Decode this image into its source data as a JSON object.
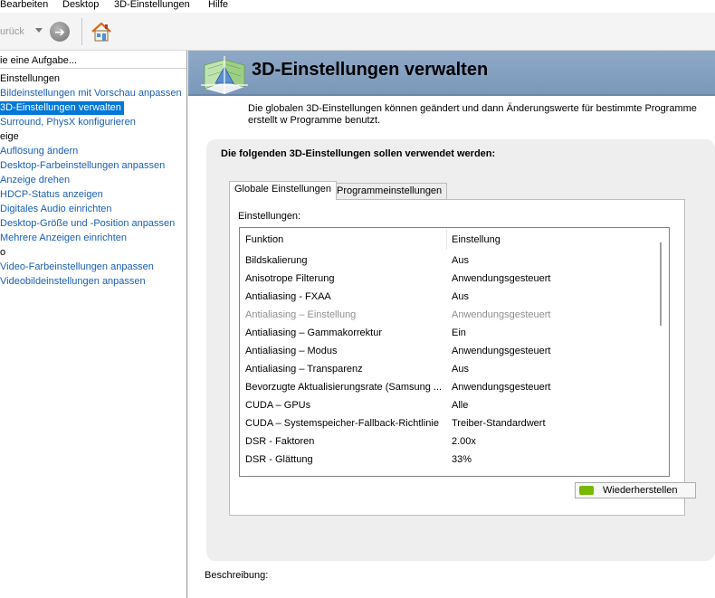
{
  "menu": [
    "Bearbeiten",
    "Desktop",
    "3D-Einstellungen",
    "Hilfe"
  ],
  "toolbar": {
    "back_label": "urück"
  },
  "left": {
    "task_header": "ie eine Aufgabe...",
    "tree": [
      {
        "text": "Einstellungen",
        "type": "cat"
      },
      {
        "text": "Bildeinstellungen mit Vorschau anpassen",
        "type": "link"
      },
      {
        "text": "3D-Einstellungen verwalten",
        "type": "sel"
      },
      {
        "text": "Surround, PhysX konfigurieren",
        "type": "link"
      },
      {
        "text": "eige",
        "type": "cat"
      },
      {
        "text": "Auflösung ändern",
        "type": "link"
      },
      {
        "text": "Desktop-Farbeinstellungen anpassen",
        "type": "link"
      },
      {
        "text": "Anzeige drehen",
        "type": "link"
      },
      {
        "text": "HDCP-Status anzeigen",
        "type": "link"
      },
      {
        "text": "Digitales Audio einrichten",
        "type": "link"
      },
      {
        "text": "Desktop-Größe und -Position anpassen",
        "type": "link"
      },
      {
        "text": "Mehrere Anzeigen einrichten",
        "type": "link"
      },
      {
        "text": "o",
        "type": "cat"
      },
      {
        "text": "Video-Farbeinstellungen anpassen",
        "type": "link"
      },
      {
        "text": "Videobildeinstellungen anpassen",
        "type": "link"
      }
    ]
  },
  "main": {
    "title": "3D-Einstellungen verwalten",
    "description": "Die globalen 3D-Einstellungen können geändert und dann Änderungswerte für bestimmte Programme erstellt w Programme benutzt.",
    "box_title": "Die folgenden 3D-Einstellungen sollen verwendet werden:",
    "tabs": [
      "Globale Einstellungen",
      "Programmeinstellungen"
    ],
    "settings_label": "Einstellungen:",
    "columns": [
      "Funktion",
      "Einstellung"
    ],
    "rows": [
      {
        "fn": "Bildskalierung",
        "val": "Aus",
        "disabled": false
      },
      {
        "fn": "Anisotrope Filterung",
        "val": "Anwendungsgesteuert",
        "disabled": false
      },
      {
        "fn": "Antialiasing - FXAA",
        "val": "Aus",
        "disabled": false
      },
      {
        "fn": "Antialiasing – Einstellung",
        "val": "Anwendungsgesteuert",
        "disabled": true
      },
      {
        "fn": "Antialiasing – Gammakorrektur",
        "val": "Ein",
        "disabled": false
      },
      {
        "fn": "Antialiasing – Modus",
        "val": "Anwendungsgesteuert",
        "disabled": false
      },
      {
        "fn": "Antialiasing – Transparenz",
        "val": "Aus",
        "disabled": false
      },
      {
        "fn": "Bevorzugte Aktualisierungsrate (Samsung ...",
        "val": "Anwendungsgesteuert",
        "disabled": false
      },
      {
        "fn": "CUDA – GPUs",
        "val": "Alle",
        "disabled": false
      },
      {
        "fn": "CUDA – Systemspeicher-Fallback-Richtlinie",
        "val": "Treiber-Standardwert",
        "disabled": false
      },
      {
        "fn": "DSR - Faktoren",
        "val": "2.00x",
        "disabled": false
      },
      {
        "fn": "DSR - Glättung",
        "val": "33%",
        "disabled": false
      }
    ],
    "restore_label": "Wiederherstellen",
    "beschreibung": "Beschreibung:"
  },
  "colors": {
    "link": "#1a5fb4",
    "selection": "#0078d7",
    "banner": "#8ea9c8",
    "nvidia": "#76b900"
  },
  "icons": [
    "chevron-down-icon",
    "forward-arrow-icon",
    "home-icon",
    "3d-settings-icon",
    "nvidia-logo-icon"
  ]
}
